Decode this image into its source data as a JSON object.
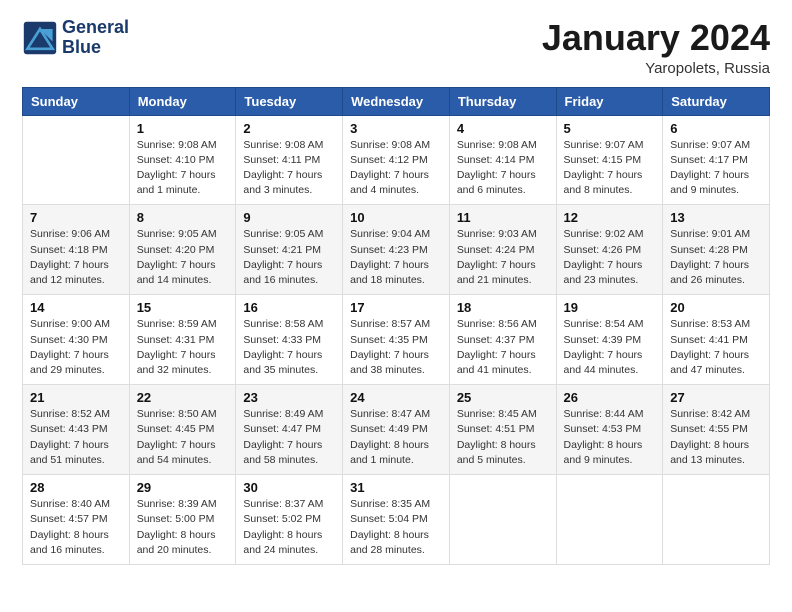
{
  "header": {
    "logo_line1": "General",
    "logo_line2": "Blue",
    "title": "January 2024",
    "subtitle": "Yaropolets, Russia"
  },
  "weekdays": [
    "Sunday",
    "Monday",
    "Tuesday",
    "Wednesday",
    "Thursday",
    "Friday",
    "Saturday"
  ],
  "weeks": [
    [
      {
        "day": "",
        "sunrise": "",
        "sunset": "",
        "daylight": ""
      },
      {
        "day": "1",
        "sunrise": "Sunrise: 9:08 AM",
        "sunset": "Sunset: 4:10 PM",
        "daylight": "Daylight: 7 hours and 1 minute."
      },
      {
        "day": "2",
        "sunrise": "Sunrise: 9:08 AM",
        "sunset": "Sunset: 4:11 PM",
        "daylight": "Daylight: 7 hours and 3 minutes."
      },
      {
        "day": "3",
        "sunrise": "Sunrise: 9:08 AM",
        "sunset": "Sunset: 4:12 PM",
        "daylight": "Daylight: 7 hours and 4 minutes."
      },
      {
        "day": "4",
        "sunrise": "Sunrise: 9:08 AM",
        "sunset": "Sunset: 4:14 PM",
        "daylight": "Daylight: 7 hours and 6 minutes."
      },
      {
        "day": "5",
        "sunrise": "Sunrise: 9:07 AM",
        "sunset": "Sunset: 4:15 PM",
        "daylight": "Daylight: 7 hours and 8 minutes."
      },
      {
        "day": "6",
        "sunrise": "Sunrise: 9:07 AM",
        "sunset": "Sunset: 4:17 PM",
        "daylight": "Daylight: 7 hours and 9 minutes."
      }
    ],
    [
      {
        "day": "7",
        "sunrise": "Sunrise: 9:06 AM",
        "sunset": "Sunset: 4:18 PM",
        "daylight": "Daylight: 7 hours and 12 minutes."
      },
      {
        "day": "8",
        "sunrise": "Sunrise: 9:05 AM",
        "sunset": "Sunset: 4:20 PM",
        "daylight": "Daylight: 7 hours and 14 minutes."
      },
      {
        "day": "9",
        "sunrise": "Sunrise: 9:05 AM",
        "sunset": "Sunset: 4:21 PM",
        "daylight": "Daylight: 7 hours and 16 minutes."
      },
      {
        "day": "10",
        "sunrise": "Sunrise: 9:04 AM",
        "sunset": "Sunset: 4:23 PM",
        "daylight": "Daylight: 7 hours and 18 minutes."
      },
      {
        "day": "11",
        "sunrise": "Sunrise: 9:03 AM",
        "sunset": "Sunset: 4:24 PM",
        "daylight": "Daylight: 7 hours and 21 minutes."
      },
      {
        "day": "12",
        "sunrise": "Sunrise: 9:02 AM",
        "sunset": "Sunset: 4:26 PM",
        "daylight": "Daylight: 7 hours and 23 minutes."
      },
      {
        "day": "13",
        "sunrise": "Sunrise: 9:01 AM",
        "sunset": "Sunset: 4:28 PM",
        "daylight": "Daylight: 7 hours and 26 minutes."
      }
    ],
    [
      {
        "day": "14",
        "sunrise": "Sunrise: 9:00 AM",
        "sunset": "Sunset: 4:30 PM",
        "daylight": "Daylight: 7 hours and 29 minutes."
      },
      {
        "day": "15",
        "sunrise": "Sunrise: 8:59 AM",
        "sunset": "Sunset: 4:31 PM",
        "daylight": "Daylight: 7 hours and 32 minutes."
      },
      {
        "day": "16",
        "sunrise": "Sunrise: 8:58 AM",
        "sunset": "Sunset: 4:33 PM",
        "daylight": "Daylight: 7 hours and 35 minutes."
      },
      {
        "day": "17",
        "sunrise": "Sunrise: 8:57 AM",
        "sunset": "Sunset: 4:35 PM",
        "daylight": "Daylight: 7 hours and 38 minutes."
      },
      {
        "day": "18",
        "sunrise": "Sunrise: 8:56 AM",
        "sunset": "Sunset: 4:37 PM",
        "daylight": "Daylight: 7 hours and 41 minutes."
      },
      {
        "day": "19",
        "sunrise": "Sunrise: 8:54 AM",
        "sunset": "Sunset: 4:39 PM",
        "daylight": "Daylight: 7 hours and 44 minutes."
      },
      {
        "day": "20",
        "sunrise": "Sunrise: 8:53 AM",
        "sunset": "Sunset: 4:41 PM",
        "daylight": "Daylight: 7 hours and 47 minutes."
      }
    ],
    [
      {
        "day": "21",
        "sunrise": "Sunrise: 8:52 AM",
        "sunset": "Sunset: 4:43 PM",
        "daylight": "Daylight: 7 hours and 51 minutes."
      },
      {
        "day": "22",
        "sunrise": "Sunrise: 8:50 AM",
        "sunset": "Sunset: 4:45 PM",
        "daylight": "Daylight: 7 hours and 54 minutes."
      },
      {
        "day": "23",
        "sunrise": "Sunrise: 8:49 AM",
        "sunset": "Sunset: 4:47 PM",
        "daylight": "Daylight: 7 hours and 58 minutes."
      },
      {
        "day": "24",
        "sunrise": "Sunrise: 8:47 AM",
        "sunset": "Sunset: 4:49 PM",
        "daylight": "Daylight: 8 hours and 1 minute."
      },
      {
        "day": "25",
        "sunrise": "Sunrise: 8:45 AM",
        "sunset": "Sunset: 4:51 PM",
        "daylight": "Daylight: 8 hours and 5 minutes."
      },
      {
        "day": "26",
        "sunrise": "Sunrise: 8:44 AM",
        "sunset": "Sunset: 4:53 PM",
        "daylight": "Daylight: 8 hours and 9 minutes."
      },
      {
        "day": "27",
        "sunrise": "Sunrise: 8:42 AM",
        "sunset": "Sunset: 4:55 PM",
        "daylight": "Daylight: 8 hours and 13 minutes."
      }
    ],
    [
      {
        "day": "28",
        "sunrise": "Sunrise: 8:40 AM",
        "sunset": "Sunset: 4:57 PM",
        "daylight": "Daylight: 8 hours and 16 minutes."
      },
      {
        "day": "29",
        "sunrise": "Sunrise: 8:39 AM",
        "sunset": "Sunset: 5:00 PM",
        "daylight": "Daylight: 8 hours and 20 minutes."
      },
      {
        "day": "30",
        "sunrise": "Sunrise: 8:37 AM",
        "sunset": "Sunset: 5:02 PM",
        "daylight": "Daylight: 8 hours and 24 minutes."
      },
      {
        "day": "31",
        "sunrise": "Sunrise: 8:35 AM",
        "sunset": "Sunset: 5:04 PM",
        "daylight": "Daylight: 8 hours and 28 minutes."
      },
      {
        "day": "",
        "sunrise": "",
        "sunset": "",
        "daylight": ""
      },
      {
        "day": "",
        "sunrise": "",
        "sunset": "",
        "daylight": ""
      },
      {
        "day": "",
        "sunrise": "",
        "sunset": "",
        "daylight": ""
      }
    ]
  ]
}
